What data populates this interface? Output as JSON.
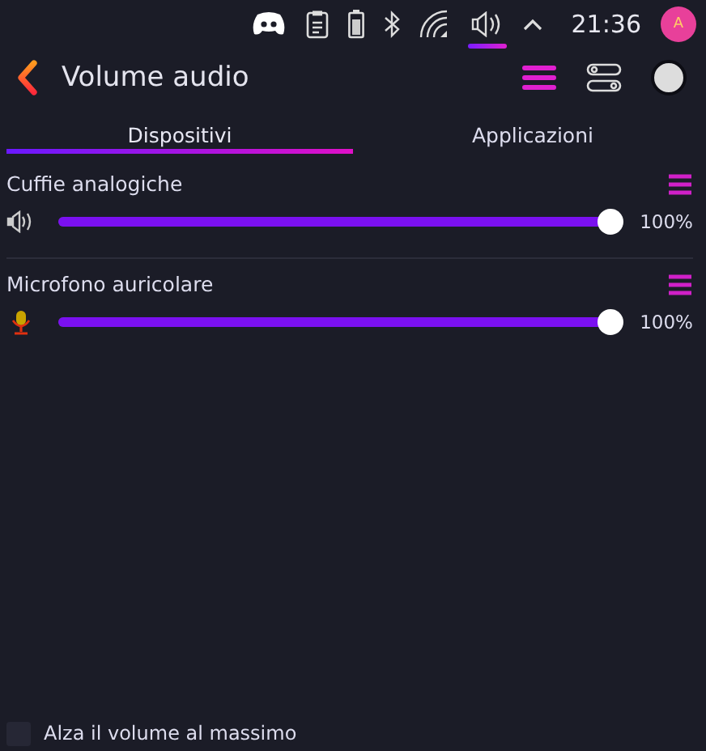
{
  "status_bar": {
    "time": "21:36",
    "avatar_letter": "A"
  },
  "header": {
    "title": "Volume audio"
  },
  "tabs": [
    {
      "label": "Dispositivi",
      "selected": true
    },
    {
      "label": "Applicazioni",
      "selected": false
    }
  ],
  "devices": [
    {
      "kind": "output",
      "name": "Cuffie analogiche",
      "level": 1,
      "reading": "100%"
    },
    {
      "kind": "input",
      "name": "Microfono auricolare",
      "level": 1,
      "reading": "100%"
    }
  ],
  "max_volume": {
    "label": "Alza il volume al massimo",
    "checked": false
  }
}
